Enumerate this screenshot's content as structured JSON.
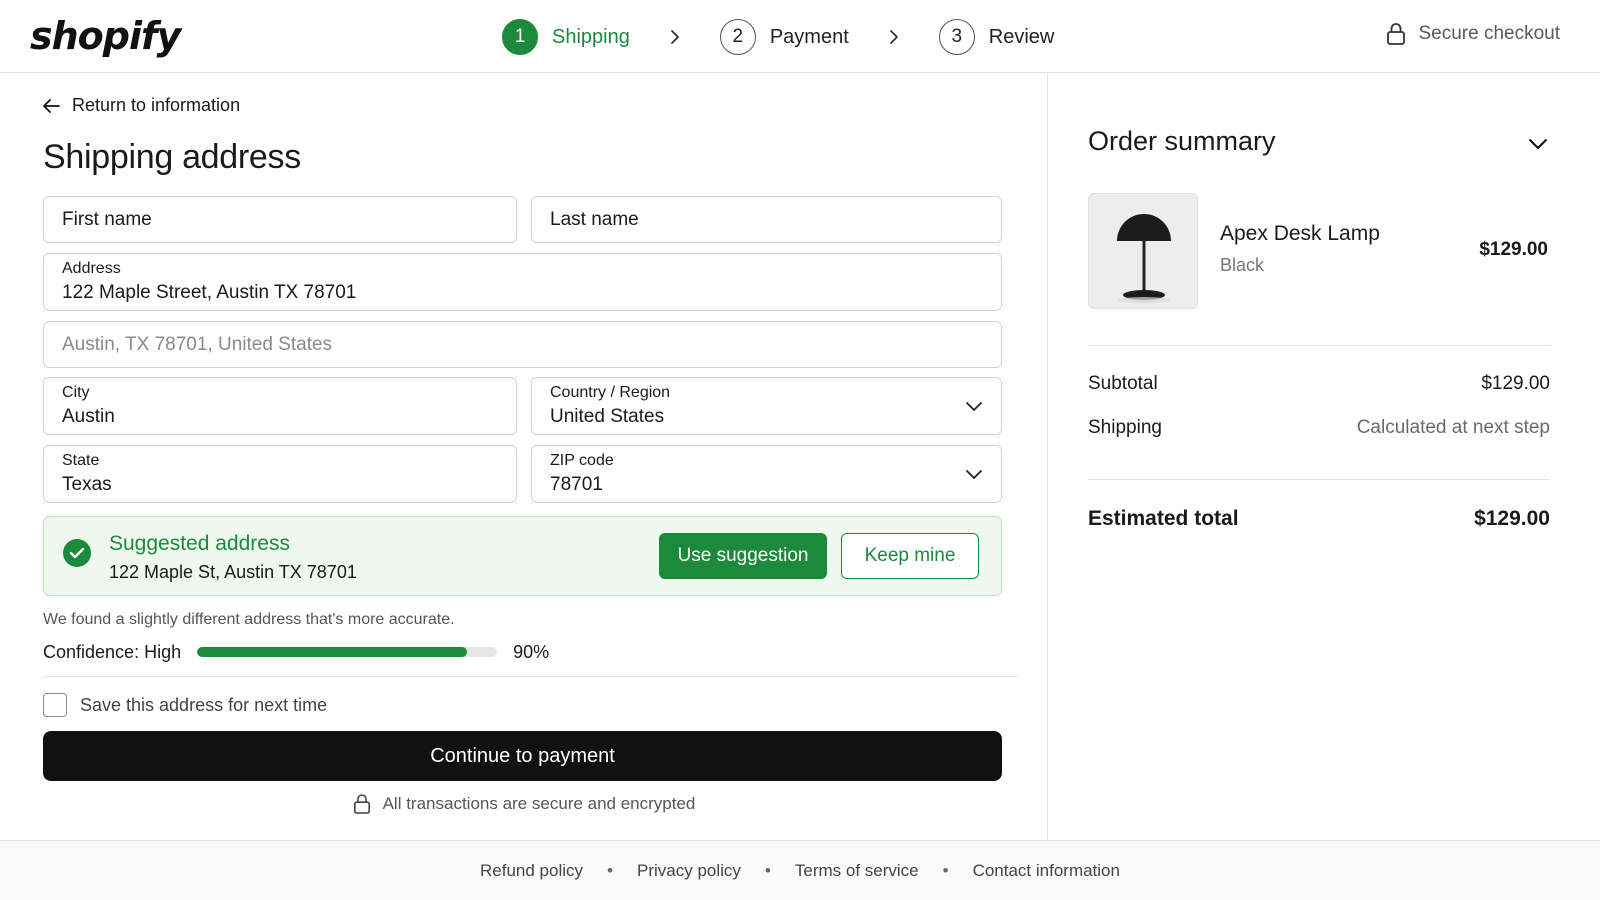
{
  "brand": {
    "logo": "shopify"
  },
  "steps": [
    {
      "number": "1",
      "label": "Shipping",
      "state": "active"
    },
    {
      "number": "2",
      "label": "Payment",
      "state": "upcoming"
    },
    {
      "number": "3",
      "label": "Review",
      "state": "upcoming"
    }
  ],
  "header": {
    "secure_label": "Secure checkout",
    "lock_icon": "lock-icon"
  },
  "form": {
    "back_link": "Return to information",
    "title": "Shipping address",
    "first_name": {
      "placeholder": "First name"
    },
    "last_name": {
      "placeholder": "Last name"
    },
    "address": {
      "label": "Address",
      "value": "122 Maple Street, Austin TX 78701"
    },
    "address2": {
      "placeholder": "Austin, TX 78701, United States"
    },
    "city": {
      "label": "City",
      "value": "Austin"
    },
    "country": {
      "label": "Country / Region",
      "value": "United States"
    },
    "state": {
      "label": "State",
      "value": "Texas"
    },
    "zip": {
      "label": "ZIP code",
      "value": "78701"
    }
  },
  "suggestion": {
    "title": "Suggested address",
    "address": "122 Maple St, Austin TX 78701",
    "use_label": "Use suggestion",
    "keep_label": "Keep mine",
    "note": "We found a slightly different address that's more accurate.",
    "confidence_label": "Confidence: High",
    "confidence_value": 90,
    "confidence_text": "90%"
  },
  "save_address": {
    "label": "Save this address for next time",
    "checked": false
  },
  "continue_label": "Continue to payment",
  "secure_note": "All transactions are secure and encrypted",
  "summary": {
    "title": "Order summary",
    "item": {
      "name": "Apex Desk Lamp",
      "variant": "Black",
      "price": "$129.00"
    },
    "subtotal_label": "Subtotal",
    "subtotal_value": "$129.00",
    "shipping_label": "Shipping",
    "shipping_value": "Calculated at next step",
    "total_label": "Estimated total",
    "total_value": "$129.00"
  },
  "footer": {
    "links": [
      "Refund policy",
      "Privacy policy",
      "Terms of service",
      "Contact information"
    ]
  },
  "colors": {
    "accent": "#1b8a3b",
    "primary_button": "#111111",
    "suggest_bg": "#eef8ef"
  }
}
